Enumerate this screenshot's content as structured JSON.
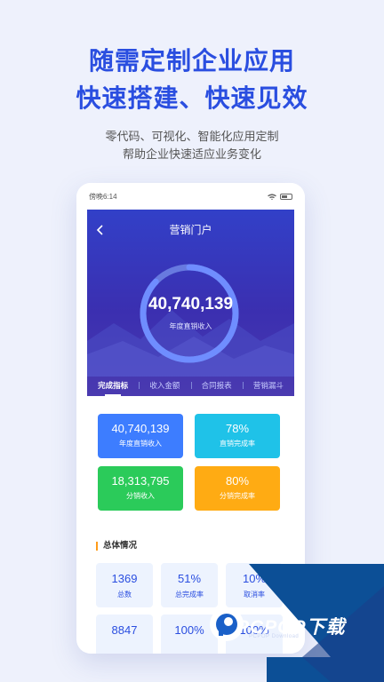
{
  "hero": {
    "title_line1": "随需定制企业应用",
    "title_line2": "快速搭建、快速见效",
    "subtitle_line1": "零代码、可视化、智能化应用定制",
    "subtitle_line2": "帮助企业快速适应业务变化"
  },
  "status_bar": {
    "time": "傍晚6:14"
  },
  "nav": {
    "title": "营销门户",
    "back_icon": "chevron-left-icon"
  },
  "ring": {
    "value": "40,740,139",
    "label": "年度直销收入",
    "progress": 0.87,
    "track_color": "#8fb2ff",
    "fill_color": "#6f8dff"
  },
  "tabs": [
    {
      "label": "完成指标",
      "active": true
    },
    {
      "label": "收入金额",
      "active": false
    },
    {
      "label": "合同报表",
      "active": false
    },
    {
      "label": "营销漏斗",
      "active": false
    }
  ],
  "kpis": [
    {
      "value": "40,740,139",
      "label": "年度直销收入",
      "color": "#3d7dff"
    },
    {
      "value": "78%",
      "label": "直销完成率",
      "color": "#1fc2e8"
    },
    {
      "value": "18,313,795",
      "label": "分销收入",
      "color": "#2bcb5a"
    },
    {
      "value": "80%",
      "label": "分销完成率",
      "color": "#ffab13"
    }
  ],
  "overall": {
    "title": "总体情况",
    "stats": [
      {
        "value": "1369",
        "label": "总数"
      },
      {
        "value": "51%",
        "label": "总完成率"
      },
      {
        "value": "10%",
        "label": "取消率"
      },
      {
        "value": "8847",
        "label": ""
      },
      {
        "value": "100%",
        "label": ""
      },
      {
        "value": "100%",
        "label": ""
      }
    ]
  },
  "watermark": {
    "brand": "PCPOP下载",
    "sub": "PCPOP Download"
  }
}
